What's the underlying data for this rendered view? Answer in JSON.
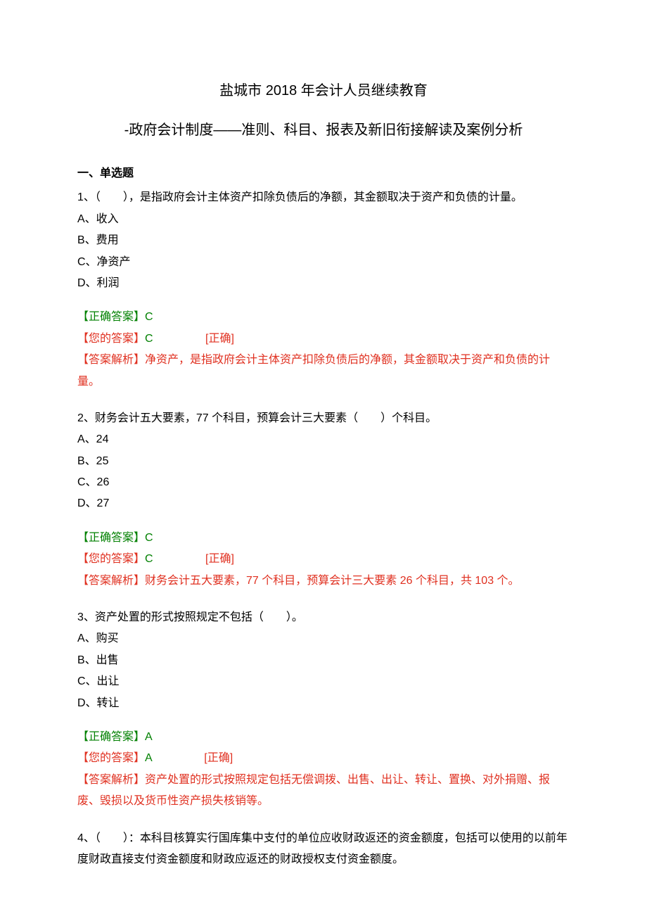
{
  "title1": "盐城市 2018 年会计人员继续教育",
  "title2": "-政府会计制度——准则、科目、报表及新旧衔接解读及案例分析",
  "sectionHeader": "一、单选题",
  "questions": [
    {
      "stem": "1、（　　），是指政府会计主体资产扣除负债后的净额，其金额取决于资产和负债的计量。",
      "opts": [
        "A、收入",
        "B、费用",
        "C、净资产",
        "D、利润"
      ],
      "correctLabel": "【正确答案】",
      "correct": "C",
      "yourLabel": "【您的答案】",
      "your": "C",
      "status": "[正确]",
      "explainLabel": "【答案解析】",
      "explain": "净资产，是指政府会计主体资产扣除负债后的净额，其金额取决于资产和负债的计量。"
    },
    {
      "stem": "2、财务会计五大要素，77 个科目，预算会计三大要素（　　）个科目。",
      "opts": [
        "A、24",
        "B、25",
        "C、26",
        "D、27"
      ],
      "correctLabel": "【正确答案】",
      "correct": "C",
      "yourLabel": "【您的答案】",
      "your": "C",
      "status": "[正确]",
      "explainLabel": "【答案解析】",
      "explain": "财务会计五大要素，77 个科目，预算会计三大要素 26 个科目，共 103 个。"
    },
    {
      "stem": "3、资产处置的形式按照规定不包括（　　）。",
      "opts": [
        "A、购买",
        "B、出售",
        "C、出让",
        "D、转让"
      ],
      "correctLabel": "【正确答案】",
      "correct": "A",
      "yourLabel": "【您的答案】",
      "your": "A",
      "status": "[正确]",
      "explainLabel": "【答案解析】",
      "explain": "资产处置的形式按照规定包括无偿调拨、出售、出让、转让、置换、对外捐赠、报废、毁损以及货币性资产损失核销等。"
    },
    {
      "stem": "4、（　　）：本科目核算实行国库集中支付的单位应收财政返还的资金额度，包括可以使用的以前年度财政直接支付资金额度和财政应返还的财政授权支付资金额度。"
    }
  ]
}
